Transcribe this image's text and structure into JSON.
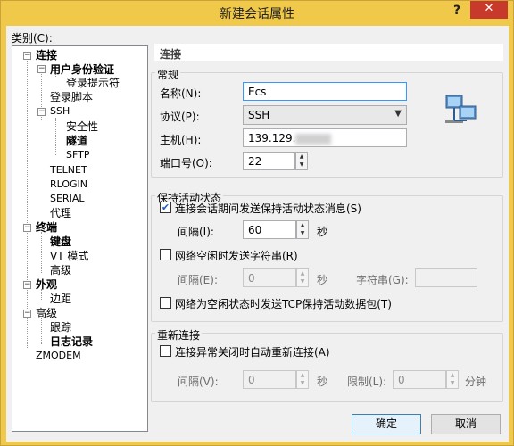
{
  "window": {
    "title": "新建会话属性",
    "help": "?",
    "close": "✕"
  },
  "category_label": "类别(C):",
  "tree": {
    "connection": "连接",
    "auth": "用户身份验证",
    "login_prompt": "登录提示符",
    "login_script": "登录脚本",
    "ssh": "SSH",
    "security": "安全性",
    "tunnel": "隧道",
    "sftp": "SFTP",
    "telnet": "TELNET",
    "rlogin": "RLOGIN",
    "serial": "SERIAL",
    "proxy": "代理",
    "terminal": "终端",
    "keyboard": "键盘",
    "vt_mode": "VT 模式",
    "advanced1": "高级",
    "appearance": "外观",
    "margin": "边距",
    "advanced2": "高级",
    "trace": "跟踪",
    "logging": "日志记录",
    "zmodem": "ZMODEM"
  },
  "panel_title": "连接",
  "general": {
    "group": "常规",
    "name_label": "名称(N):",
    "name_value": "Ecs",
    "protocol_label": "协议(P):",
    "protocol_value": "SSH",
    "host_label": "主机(H):",
    "host_value": "139.129.",
    "port_label": "端口号(O):",
    "port_value": "22"
  },
  "keepalive": {
    "group": "保持活动状态",
    "send_check": "连接会话期间发送保持活动状态消息(S)",
    "interval_label": "间隔(I):",
    "interval_value": "60",
    "sec": "秒",
    "idle_str_check": "网络空闲时发送字符串(R)",
    "interval2_label": "间隔(E):",
    "interval2_value": "0",
    "sec2": "秒",
    "string_label": "字符串(G):",
    "tcp_check": "网络为空闲状态时发送TCP保持活动数据包(T)"
  },
  "reconnect": {
    "group": "重新连接",
    "auto_check": "连接异常关闭时自动重新连接(A)",
    "interval_label": "间隔(V):",
    "interval_value": "0",
    "sec": "秒",
    "limit_label": "限制(L):",
    "limit_value": "0",
    "minutes": "分钟"
  },
  "buttons": {
    "ok": "确定",
    "cancel": "取消"
  }
}
